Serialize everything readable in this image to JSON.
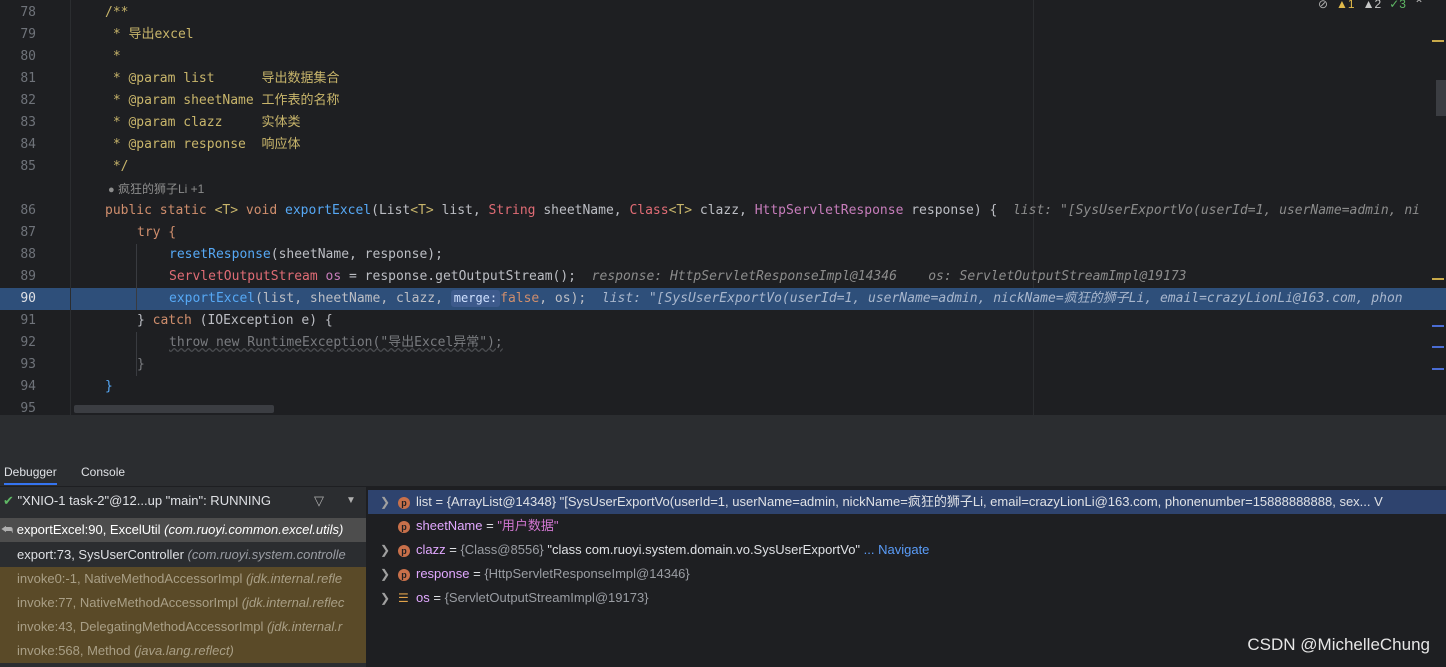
{
  "editor": {
    "line_numbers": [
      "78",
      "79",
      "80",
      "81",
      "82",
      "83",
      "84",
      "85",
      "86",
      "87",
      "88",
      "89",
      "90",
      "91",
      "92",
      "93",
      "94",
      "95"
    ],
    "lines": {
      "l78": "/**",
      "l79": " * 导出excel",
      "l80": " *",
      "l81": " * @param list      导出数据集合",
      "l82": " * @param sheetName 工作表的名称",
      "l83": " * @param clazz     实体类",
      "l84": " * @param response  响应体",
      "l85": " */",
      "author": "疯狂的狮子Li +1",
      "l86_kw1": "public static ",
      "l86_t": "<T>",
      "l86_void": " void ",
      "l86_fn": "exportExcel",
      "l86_p1": "(List",
      "l86_t2": "<T>",
      "l86_p2": " list, ",
      "l86_str": "String",
      "l86_p3": " sheetName, ",
      "l86_cls": "Class",
      "l86_t3": "<T>",
      "l86_p4": " clazz, ",
      "l86_resp": "HttpServletResponse",
      "l86_p5": " response) {",
      "l86_hint": "list: \"[SysUserExportVo(userId=1, userName=admin, ni",
      "l87": "try {",
      "l88_fn": "resetResponse",
      "l88_rest": "(sheetName, response);",
      "l89_type": "ServletOutputStream",
      "l89_os": " os",
      "l89_rest": " = response.getOutputStream();",
      "l89_hint": "response: HttpServletResponseImpl@14346    os: ServletOutputStreamImpl@19173",
      "l90_fn": "exportExcel",
      "l90_args": "(list, sheetName, clazz, ",
      "l90_merge": "merge:",
      "l90_false": "false",
      "l90_end": ", os);",
      "l90_hint": "list: \"[SysUserExportVo(userId=1, userName=admin, nickName=疯狂的狮子Li, email=crazyLionLi@163.com, phon",
      "l91_a": "} ",
      "l91_catch": "catch",
      "l91_b": " (IOException e) {",
      "l92": "throw new RuntimeException(\"导出Excel异常\");",
      "l93": "}",
      "l94": "}"
    },
    "inspection": {
      "warn1": "1",
      "warn2": "2",
      "ok": "3"
    }
  },
  "tabs": {
    "debugger": "Debugger",
    "console": "Console"
  },
  "frames": {
    "thread": "\"XNIO-1 task-2\"@12...up \"main\": RUNNING",
    "items": [
      {
        "method": "exportExcel:90, ExcelUtil ",
        "pkg": "(com.ruoyi.common.excel.utils)"
      },
      {
        "method": "export:73, SysUserController ",
        "pkg": "(com.ruoyi.system.controlle"
      },
      {
        "method": "invoke0:-1, NativeMethodAccessorImpl ",
        "pkg": "(jdk.internal.refle"
      },
      {
        "method": "invoke:77, NativeMethodAccessorImpl ",
        "pkg": "(jdk.internal.reflec"
      },
      {
        "method": "invoke:43, DelegatingMethodAccessorImpl ",
        "pkg": "(jdk.internal.r"
      },
      {
        "method": "invoke:568, Method ",
        "pkg": "(java.lang.reflect)"
      }
    ]
  },
  "variables": [
    {
      "name": "list",
      "eq": " = ",
      "ref": "{ArrayList@14348} ",
      "value": "\"[SysUserExportVo(userId=1, userName=admin, nickName=疯狂的狮子Li, email=crazyLionLi@163.com, phonenumber=15888888888, sex... V"
    },
    {
      "name": "sheetName",
      "eq": " = ",
      "ref": "",
      "value": "\"用户数据\""
    },
    {
      "name": "clazz",
      "eq": " = ",
      "ref": "{Class@8556} ",
      "value": "\"class com.ruoyi.system.domain.vo.SysUserExportVo\"",
      "link": " ... Navigate"
    },
    {
      "name": "response",
      "eq": " = ",
      "ref": "{HttpServletResponseImpl@14346}",
      "value": ""
    },
    {
      "name": "os",
      "eq": " = ",
      "ref": "{ServletOutputStreamImpl@19173}",
      "value": ""
    }
  ],
  "watermark": "CSDN @MichelleChung",
  "colors": {
    "editor_bg": "#1e1f22",
    "exec_line": "#2e4f7a",
    "selected_frame": "#6b5a2a",
    "frames_bg": "#2b2d30",
    "accent": "#3574f0"
  }
}
